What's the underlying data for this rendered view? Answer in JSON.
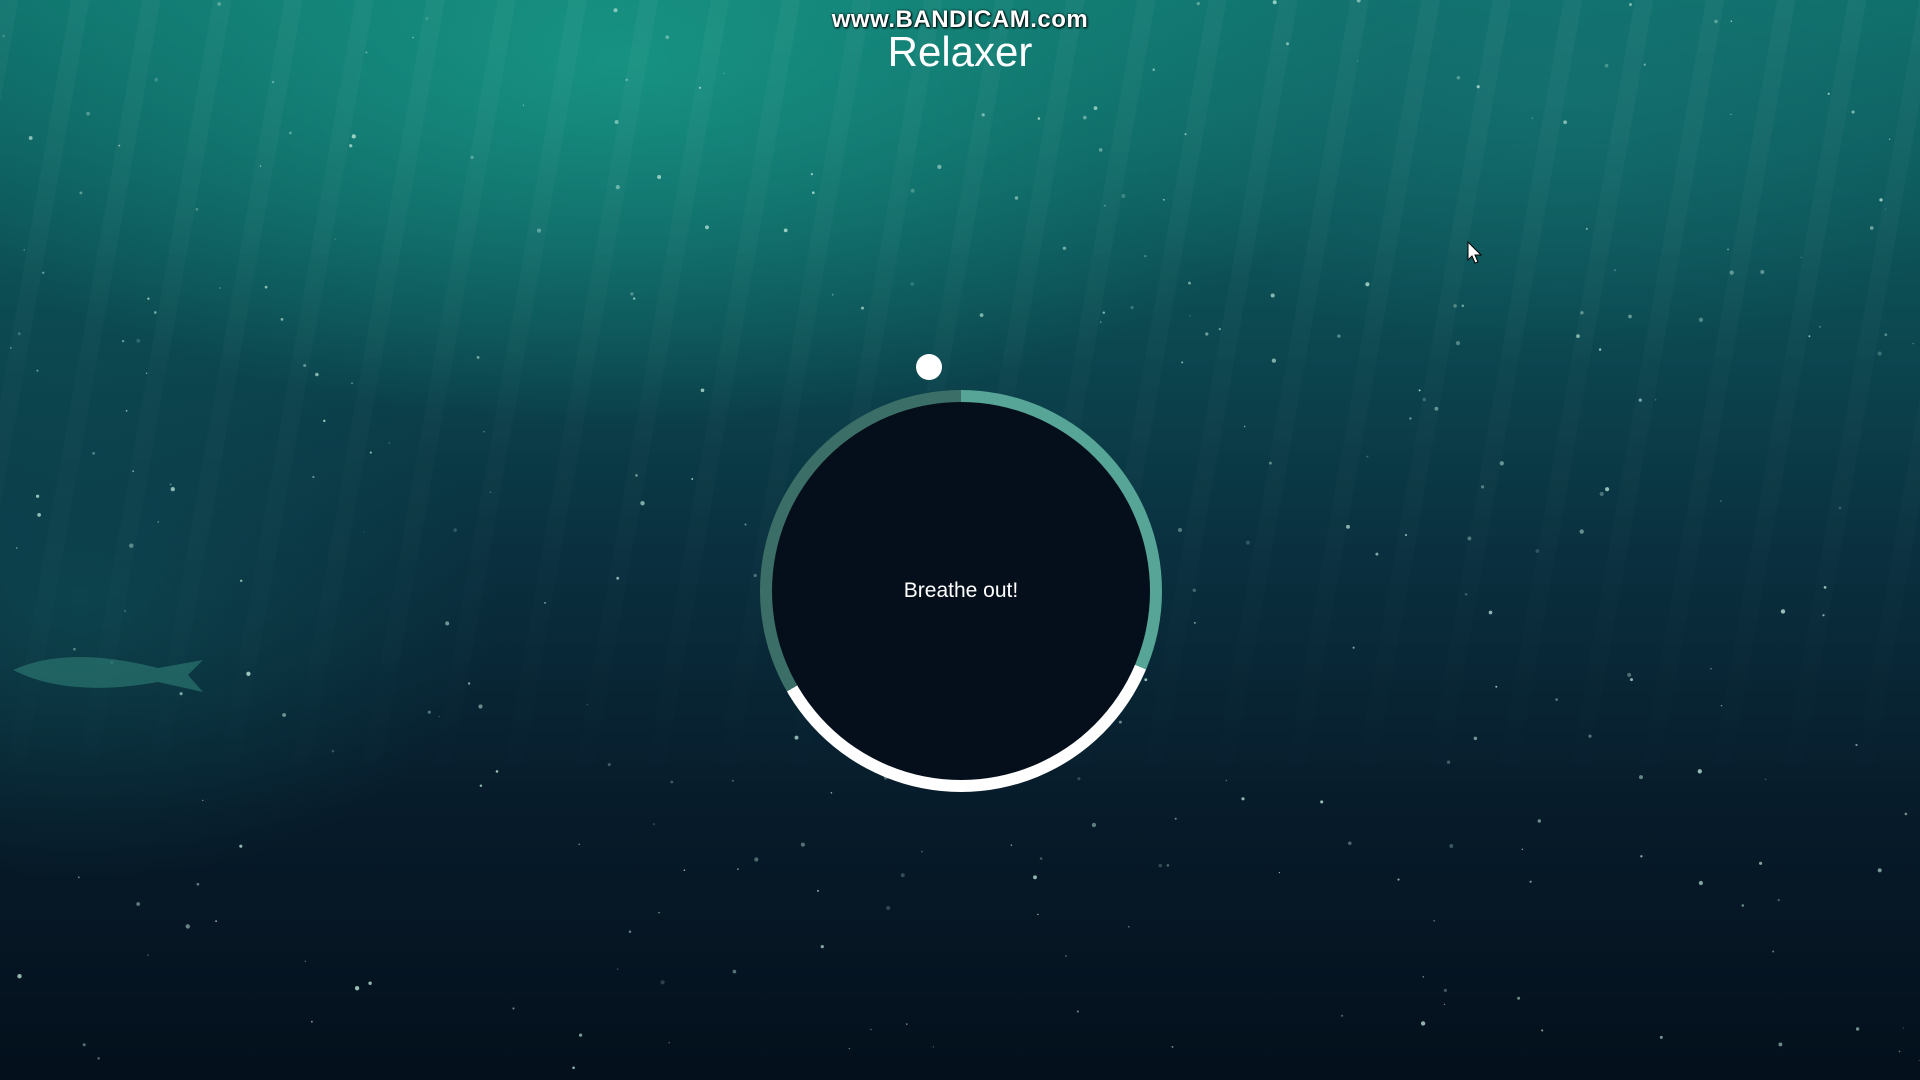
{
  "watermark": {
    "text": "www.BANDICAM.com"
  },
  "app": {
    "title": "Relaxer"
  },
  "breathing": {
    "status_text": "Breathe out!",
    "ring_colors": {
      "accent": "#56a597",
      "highlight": "#ffffff",
      "muted": "#3b6e66",
      "inner": "#040f1b"
    }
  },
  "background": {
    "scene": "underwater",
    "colors": {
      "top": "#0f6f6a",
      "bottom": "#04101c"
    }
  },
  "icons": {
    "pointer": "pointer-dot-icon",
    "cursor": "mouse-cursor-icon"
  }
}
